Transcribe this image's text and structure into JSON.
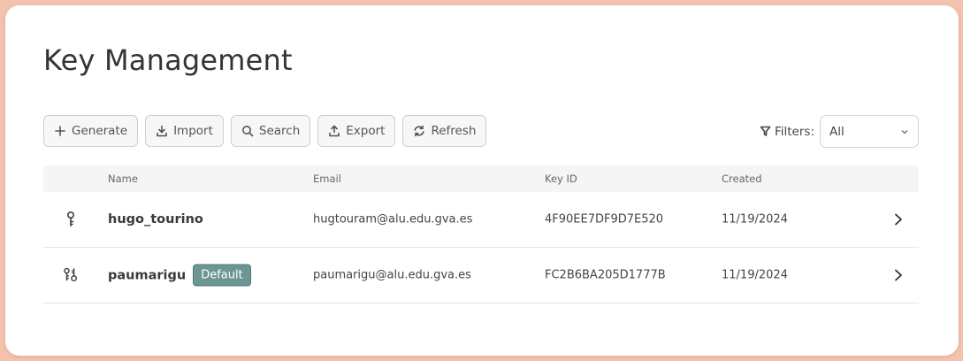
{
  "page": {
    "title": "Key Management"
  },
  "toolbar": {
    "generate_label": "Generate",
    "import_label": "Import",
    "search_label": "Search",
    "export_label": "Export",
    "refresh_label": "Refresh"
  },
  "filters": {
    "label": "Filters:",
    "selected": "All"
  },
  "table": {
    "columns": {
      "name": "Name",
      "email": "Email",
      "key_id": "Key ID",
      "created": "Created"
    },
    "rows": [
      {
        "icon": "key-icon",
        "name": "hugo_tourino",
        "badge": "",
        "email": "hugtouram@alu.edu.gva.es",
        "key_id": "4F90EE7DF9D7E520",
        "created": "11/19/2024"
      },
      {
        "icon": "key-pair-icon",
        "name": "paumarigu",
        "badge": "Default",
        "email": "paumarigu@alu.edu.gva.es",
        "key_id": "FC2B6BA205D1777B",
        "created": "11/19/2024"
      }
    ]
  },
  "colors": {
    "background": "#f3c3ad",
    "badge": "#6b9694"
  }
}
